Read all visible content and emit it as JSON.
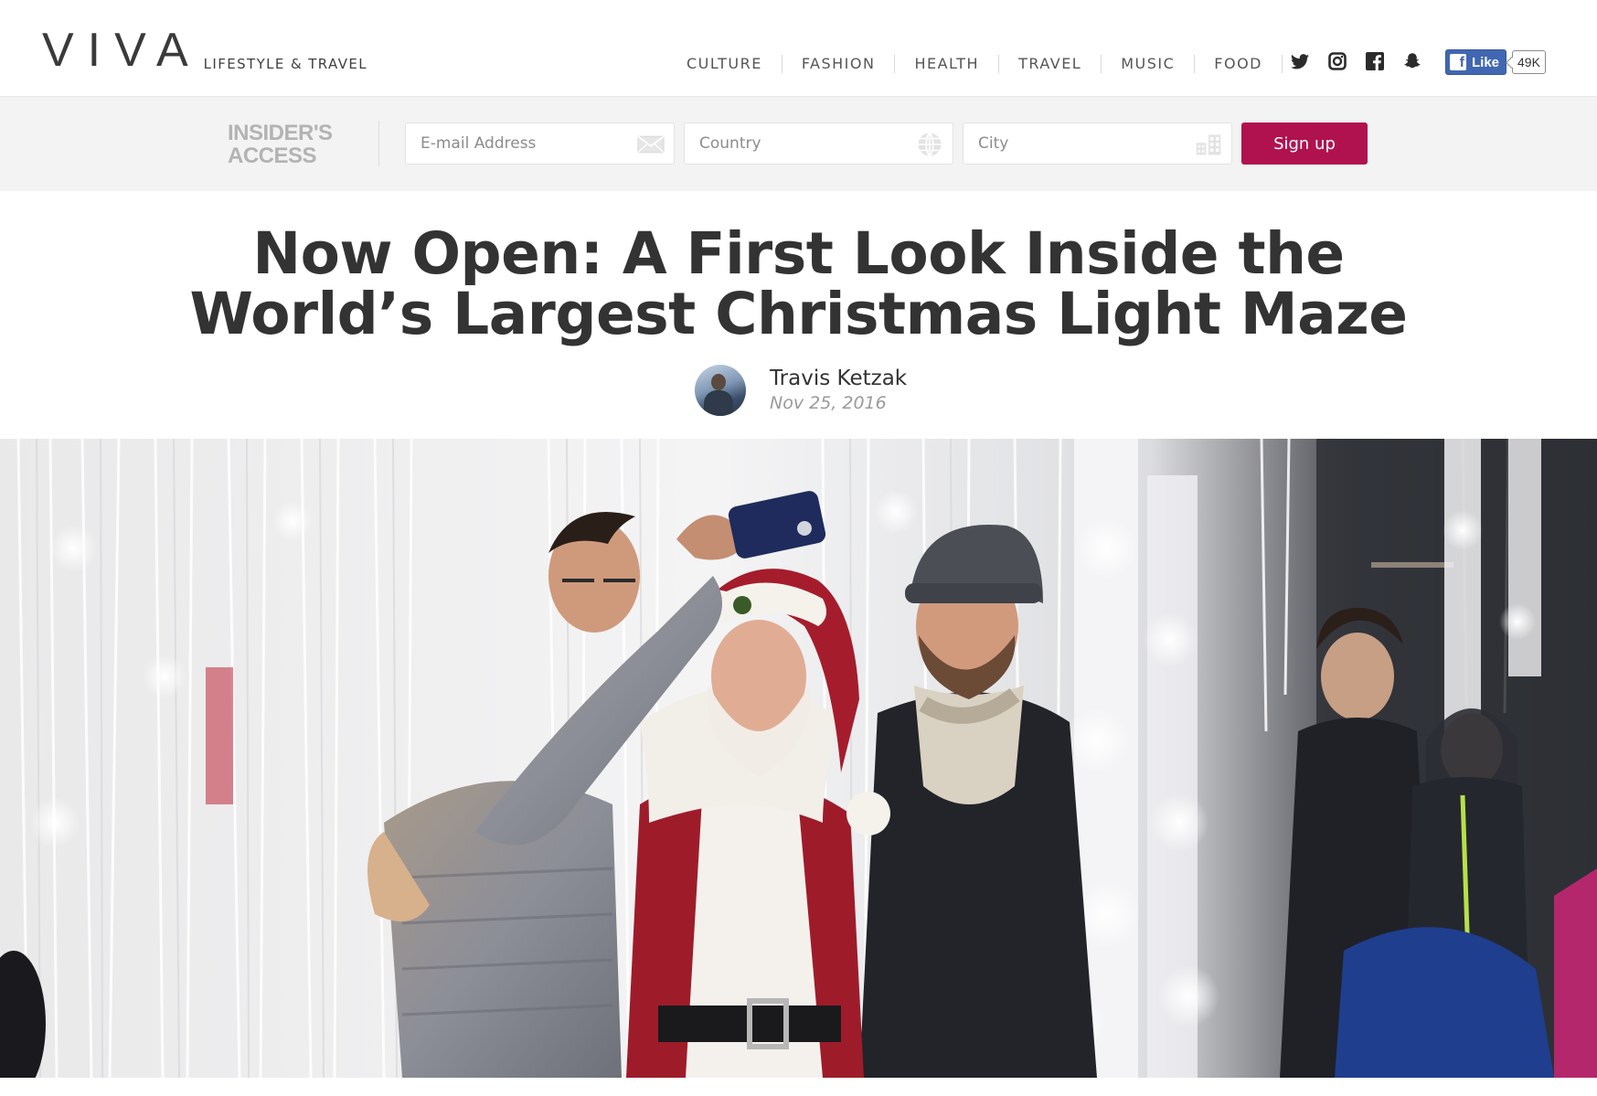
{
  "brand": {
    "logo_word": "VIVA",
    "tagline": "LIFESTYLE & TRAVEL"
  },
  "nav": {
    "items": [
      "CULTURE",
      "FASHION",
      "HEALTH",
      "TRAVEL",
      "MUSIC",
      "FOOD"
    ]
  },
  "social": {
    "icons": [
      "twitter-icon",
      "instagram-icon",
      "facebook-icon",
      "snapchat-icon"
    ],
    "fb_like_label": "Like",
    "fb_like_count": "49K"
  },
  "signup": {
    "heading_line1": "INSIDER'S",
    "heading_line2": "ACCESS",
    "email_placeholder": "E-mail Address",
    "country_placeholder": "Country",
    "city_placeholder": "City",
    "button_label": "Sign up",
    "button_color": "#b0124f"
  },
  "article": {
    "title_line1": "Now Open: A First Look Inside the",
    "title_line2": "World’s Largest Christmas Light Maze",
    "author": "Travis Ketzak",
    "date": "Nov 25, 2016"
  }
}
